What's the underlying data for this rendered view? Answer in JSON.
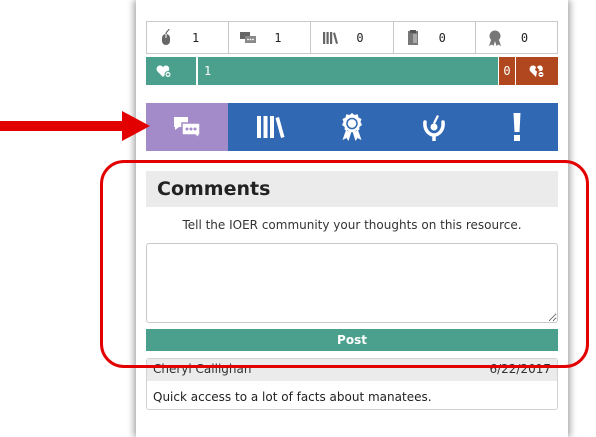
{
  "stats": [
    {
      "icon": "mouse-icon",
      "value": "1"
    },
    {
      "icon": "comments-icon",
      "value": "1"
    },
    {
      "icon": "library-icon",
      "value": "0"
    },
    {
      "icon": "clipboard-icon",
      "value": "0"
    },
    {
      "icon": "award-ribbon-icon",
      "value": "0"
    }
  ],
  "rating": {
    "likes": "1",
    "dislikes": "0"
  },
  "tabs": [
    {
      "icon": "comments-icon",
      "active": true
    },
    {
      "icon": "library-icon",
      "active": false
    },
    {
      "icon": "award-ribbon-icon",
      "active": false
    },
    {
      "icon": "standards-icon",
      "active": false
    },
    {
      "icon": "report-icon",
      "active": false
    }
  ],
  "comments": {
    "title": "Comments",
    "prompt": "Tell the IOER community your thoughts on this resource.",
    "input_value": "",
    "post_label": "Post",
    "items": [
      {
        "author": "Cheryl Callighan",
        "date": "6/22/2017",
        "text": "Quick access to a lot of facts about manatees."
      }
    ]
  },
  "colors": {
    "tab_blue": "#3068b3",
    "tab_active": "#a28bc8",
    "like_green": "#4aa08d",
    "dislike_red": "#b0471f",
    "annotation_red": "#e20000"
  }
}
